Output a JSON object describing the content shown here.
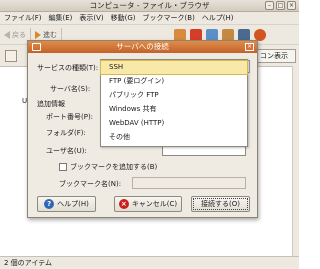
{
  "window": {
    "title": "コンピュータ - ファイル・ブラウザ"
  },
  "menubar": [
    "ファイル(F)",
    "編集(E)",
    "表示(V)",
    "移動(G)",
    "ブックマーク(B)",
    "ヘルプ(H)"
  ],
  "toolbar": {
    "back_label": "戻る",
    "forward_label": "進む"
  },
  "view_combo": "コン表示",
  "content": {
    "partial_text": "US"
  },
  "statusbar": "2 個のアイテム",
  "dialog": {
    "title": "サーバへの接続",
    "service_type_label": "サービスの種類(T):",
    "server_label": "サーバ名(S):",
    "extra_info_label": "追加情報",
    "port_label": "ポート番号(P):",
    "folder_label": "フォルダ(F):",
    "user_label": "ユーザ名(U):",
    "bookmark_checkbox_label": "ブックマークを追加する(B)",
    "bookmark_name_label": "ブックマーク名(N):",
    "service_options": [
      "SSH",
      "FTP (要ログイン)",
      "パブリック FTP",
      "Windows 共有",
      "WebDAV (HTTP)",
      "その他"
    ],
    "selected_option": "SSH",
    "help_button": "ヘルプ(H)",
    "cancel_button": "キャンセル(C)",
    "connect_button": "接続する(O)"
  }
}
